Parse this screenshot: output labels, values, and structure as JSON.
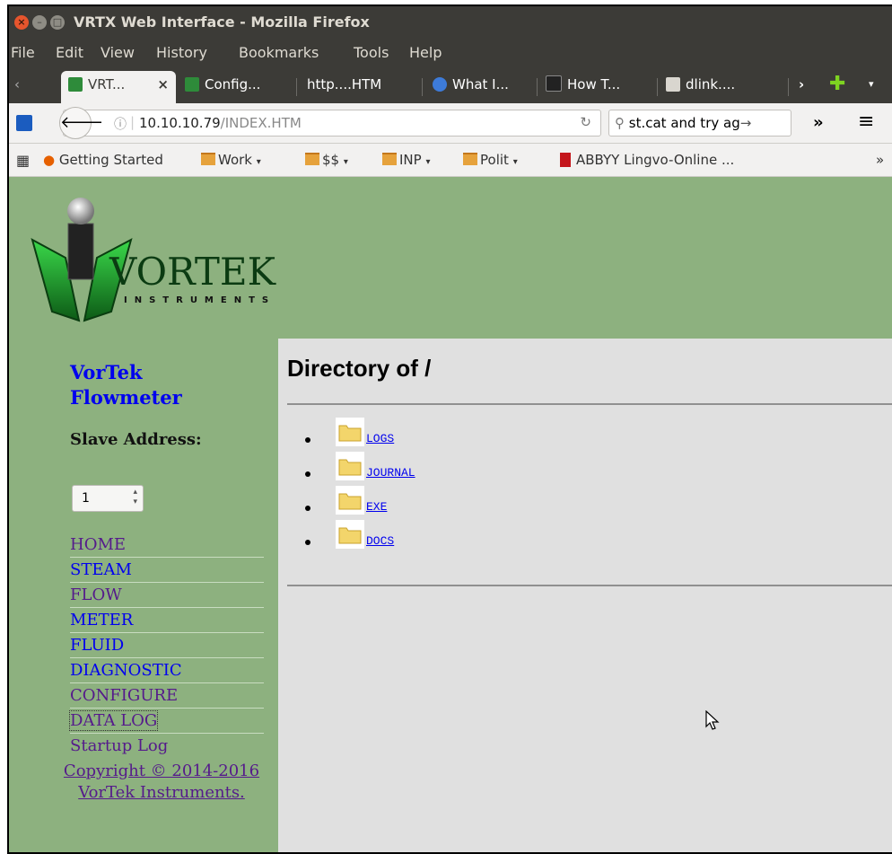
{
  "window": {
    "title": "VRTX Web Interface - Mozilla Firefox"
  },
  "menubar": [
    "File",
    "Edit",
    "View",
    "History",
    "Bookmarks",
    "Tools",
    "Help"
  ],
  "tabs": [
    {
      "label": "VRT...",
      "active": true,
      "close": "×"
    },
    {
      "label": "Config..."
    },
    {
      "label": "http....HTM"
    },
    {
      "label": "What I..."
    },
    {
      "label": "How T..."
    },
    {
      "label": "dlink...."
    }
  ],
  "urlbar": {
    "host": "10.10.10.79",
    "path": "/INDEX.HTM"
  },
  "search": {
    "value": "st.cat and try ag"
  },
  "bookmarks": [
    "Getting Started",
    "Work",
    "$$",
    "INP",
    "Polit",
    "ABBYY Lingvo-Online ..."
  ],
  "sidebar": {
    "product": "VorTek Flowmeter",
    "slave_label": "Slave Address:",
    "slave_value": "1",
    "nav": [
      "HOME",
      "STEAM",
      "FLOW",
      "METER",
      "FLUID",
      "DIAGNOSTIC",
      "CONFIGURE",
      "DATA LOG",
      "Startup Log"
    ],
    "copyright_line1": "Copyright © 2014-2016",
    "copyright_line2": "VorTek Instruments."
  },
  "logo": {
    "name": "VORTEK",
    "sub": "INSTRUMENTS"
  },
  "main": {
    "heading": "Directory of /",
    "entries": [
      "LOGS",
      "JOURNAL",
      "EXE",
      "DOCS"
    ]
  },
  "colors": {
    "page_bg": "#8db17f",
    "content_bg": "#e0e0e0",
    "link": "#0000ee",
    "visited": "#551a8b"
  }
}
